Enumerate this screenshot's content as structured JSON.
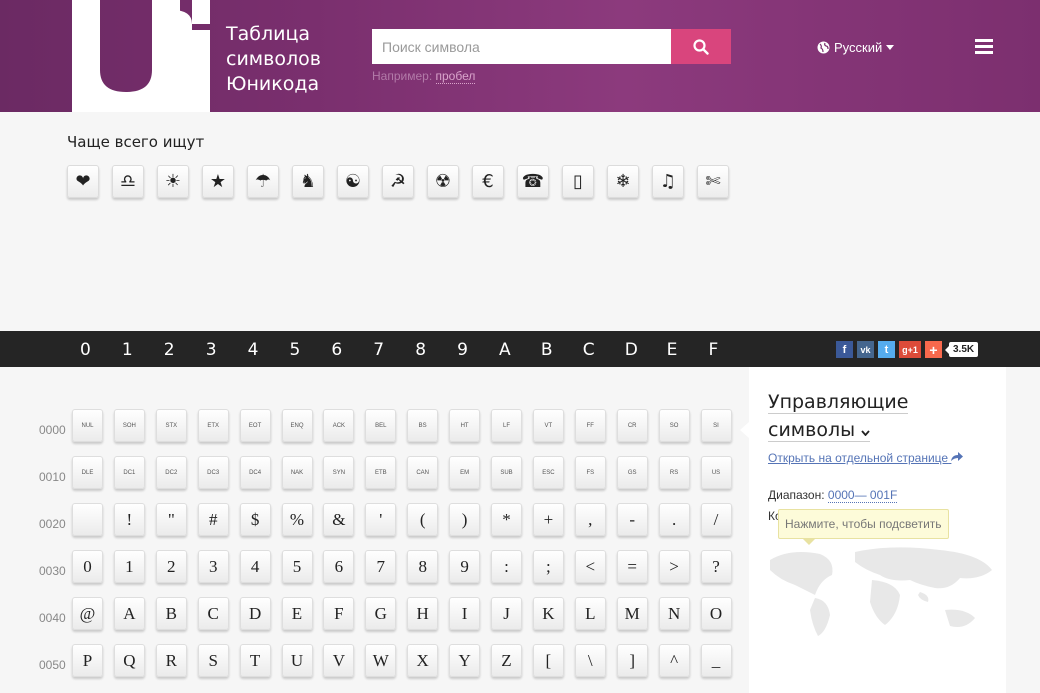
{
  "header": {
    "title_lines": [
      "Таблица",
      "символов",
      "Юникода"
    ],
    "search_placeholder": "Поиск символа",
    "hint_prefix": "Например:",
    "hint_example": "пробел",
    "language": "Русский",
    "brand_color": "#7a2f6e",
    "accent_color": "#d9457d"
  },
  "popular": {
    "title": "Чаще всего ищут",
    "items": [
      "❤",
      "♎",
      "☀",
      "★",
      "☂",
      "♞",
      "☯",
      "☭",
      "☢",
      "€",
      "☎",
      "▯",
      "❄",
      "♫",
      "✄"
    ]
  },
  "hex_columns": [
    "0",
    "1",
    "2",
    "3",
    "4",
    "5",
    "6",
    "7",
    "8",
    "9",
    "A",
    "B",
    "C",
    "D",
    "E",
    "F"
  ],
  "social": {
    "count": "3.5K",
    "labels": [
      "f",
      "vk",
      "t",
      "g+1",
      "+"
    ]
  },
  "table": {
    "rows": [
      {
        "label": "0000",
        "ctrl": true,
        "cells": [
          "NUL",
          "SOH",
          "STX",
          "ETX",
          "EOT",
          "ENQ",
          "ACK",
          "BEL",
          "BS",
          "HT",
          "LF",
          "VT",
          "FF",
          "CR",
          "SO",
          "SI"
        ]
      },
      {
        "label": "0010",
        "ctrl": true,
        "cells": [
          "DLE",
          "DC1",
          "DC2",
          "DC3",
          "DC4",
          "NAK",
          "SYN",
          "ETB",
          "CAN",
          "EM",
          "SUB",
          "ESC",
          "FS",
          "GS",
          "RS",
          "US"
        ]
      },
      {
        "label": "0020",
        "ctrl": false,
        "cells": [
          " ",
          "!",
          "\"",
          "#",
          "$",
          "%",
          "&",
          "'",
          "(",
          ")",
          "*",
          "+",
          ",",
          "-",
          ".",
          "/"
        ]
      },
      {
        "label": "0030",
        "ctrl": false,
        "cells": [
          "0",
          "1",
          "2",
          "3",
          "4",
          "5",
          "6",
          "7",
          "8",
          "9",
          ":",
          ";",
          "<",
          "=",
          ">",
          "?"
        ]
      },
      {
        "label": "0040",
        "ctrl": false,
        "cells": [
          "@",
          "A",
          "B",
          "C",
          "D",
          "E",
          "F",
          "G",
          "H",
          "I",
          "J",
          "K",
          "L",
          "M",
          "N",
          "O"
        ]
      },
      {
        "label": "0050",
        "ctrl": false,
        "cells": [
          "P",
          "Q",
          "R",
          "S",
          "T",
          "U",
          "V",
          "W",
          "X",
          "Y",
          "Z",
          "[",
          "\\",
          "]",
          "^",
          "_"
        ]
      }
    ]
  },
  "side": {
    "title_line1": "Управляющие",
    "title_line2": "символы",
    "open_link": "Открыть на отдельной странице",
    "range_label": "Диапазон:",
    "range_value": "0000— 001F",
    "ko_label": "Ко",
    "tooltip": "Нажмите, чтобы подсветить"
  }
}
